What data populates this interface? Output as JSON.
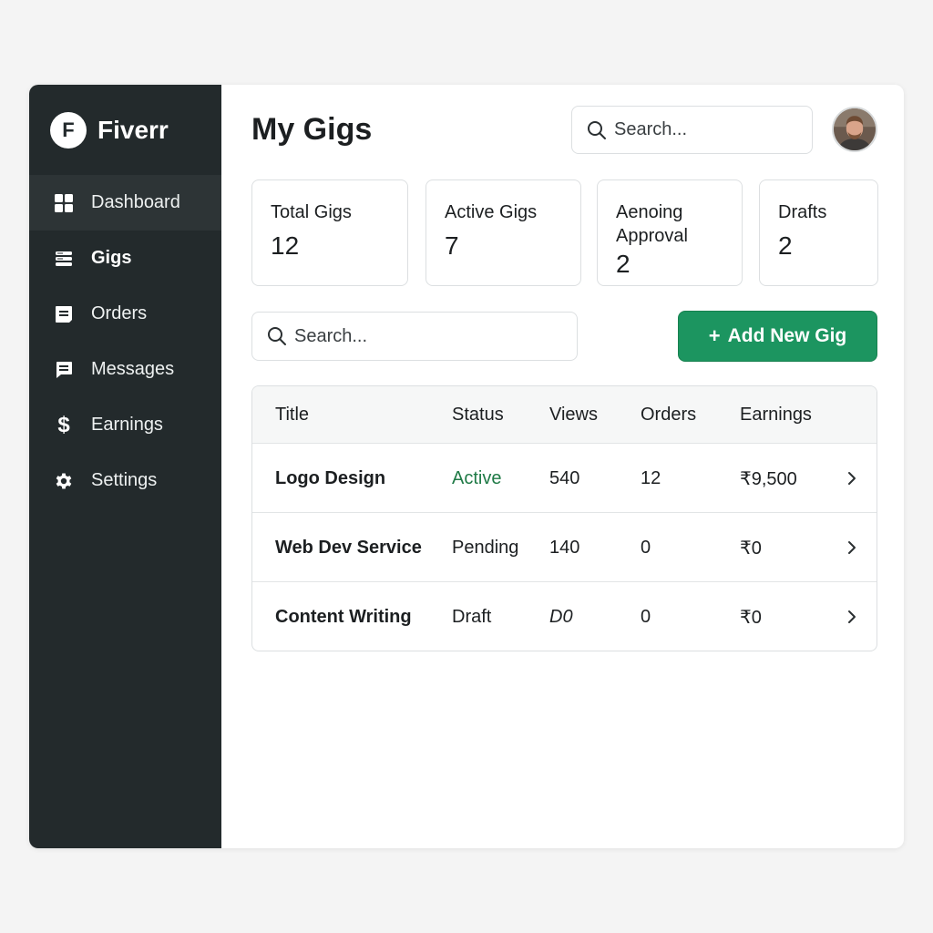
{
  "brand": {
    "logo_letter": "F",
    "name": "Fiverr"
  },
  "sidebar": {
    "items": [
      {
        "label": "Dashboard",
        "icon": "grid-icon"
      },
      {
        "label": "Gigs",
        "icon": "list-icon"
      },
      {
        "label": "Orders",
        "icon": "receipt-icon"
      },
      {
        "label": "Messages",
        "icon": "chat-icon"
      },
      {
        "label": "Earnings",
        "icon": "dollar-icon",
        "glyph": "$"
      },
      {
        "label": "Settings",
        "icon": "gear-icon"
      }
    ]
  },
  "header": {
    "title": "My Gigs",
    "search_placeholder": "Search..."
  },
  "stats": [
    {
      "label": "Total Gigs",
      "value": "12"
    },
    {
      "label": "Active Gigs",
      "value": "7"
    },
    {
      "label": "Aenoing Approval",
      "value": "2"
    },
    {
      "label": "Drafts",
      "value": "2"
    }
  ],
  "toolbar": {
    "search_placeholder": "Search...",
    "add_plus": "+",
    "add_label": "Add New Gig"
  },
  "table": {
    "columns": [
      "Title",
      "Status",
      "Views",
      "Orders",
      "Earnings"
    ],
    "rows": [
      {
        "title": "Logo Design",
        "status": "Active",
        "views": "540",
        "orders": "12",
        "earnings": "₹9,500"
      },
      {
        "title": "Web Dev Service",
        "status": "Pending",
        "views": "140",
        "orders": "0",
        "earnings": "₹0"
      },
      {
        "title": "Content Writing",
        "status": "Draft",
        "views": "D0",
        "orders": "0",
        "earnings": "₹0"
      }
    ]
  },
  "colors": {
    "sidebar_bg": "#232a2c",
    "accent_green": "#1c9560",
    "status_active": "#1f7a46"
  }
}
